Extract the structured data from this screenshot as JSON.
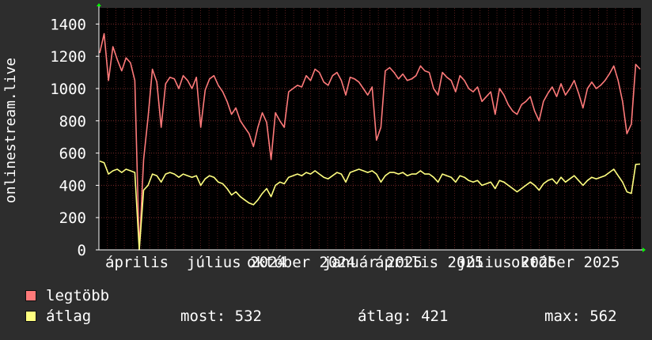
{
  "chart_data": {
    "type": "line",
    "ylabel": "onlinestream.live",
    "ylim": [
      0,
      1500
    ],
    "yticks": [
      0,
      200,
      400,
      600,
      800,
      1000,
      1200,
      1400
    ],
    "grid": true,
    "xticklabels": [
      "április",
      "július 2024",
      "október 2024",
      "január 2025",
      "április 2025",
      "július 2025",
      "október 2025"
    ],
    "series": [
      {
        "name": "legtöbb",
        "color": "#ff7a7a",
        "values": [
          1220,
          1340,
          1050,
          1260,
          1180,
          1110,
          1190,
          1160,
          1050,
          0,
          560,
          820,
          1120,
          1040,
          760,
          1030,
          1070,
          1060,
          1000,
          1080,
          1050,
          1000,
          1070,
          760,
          990,
          1060,
          1080,
          1020,
          980,
          920,
          840,
          880,
          800,
          760,
          720,
          640,
          760,
          850,
          790,
          560,
          850,
          800,
          760,
          980,
          1000,
          1020,
          1010,
          1080,
          1050,
          1120,
          1100,
          1040,
          1020,
          1080,
          1100,
          1050,
          960,
          1070,
          1060,
          1040,
          1000,
          960,
          1010,
          680,
          760,
          1110,
          1130,
          1100,
          1060,
          1090,
          1050,
          1060,
          1080,
          1140,
          1110,
          1100,
          1000,
          960,
          1100,
          1070,
          1050,
          980,
          1080,
          1050,
          1000,
          980,
          1010,
          920,
          950,
          980,
          840,
          1000,
          960,
          900,
          860,
          840,
          900,
          920,
          950,
          860,
          800,
          920,
          970,
          1010,
          950,
          1030,
          960,
          1000,
          1050,
          970,
          880,
          1000,
          1040,
          1000,
          1020,
          1050,
          1090,
          1140,
          1050,
          920,
          720,
          780,
          1150,
          1120
        ]
      },
      {
        "name": "átlag",
        "color": "#ffff80",
        "values": [
          550,
          540,
          470,
          490,
          500,
          480,
          500,
          490,
          480,
          0,
          370,
          400,
          470,
          460,
          420,
          470,
          480,
          470,
          450,
          470,
          460,
          450,
          460,
          400,
          440,
          460,
          450,
          420,
          410,
          380,
          340,
          360,
          330,
          310,
          290,
          280,
          310,
          350,
          380,
          330,
          400,
          420,
          410,
          450,
          460,
          470,
          460,
          480,
          470,
          490,
          470,
          450,
          440,
          460,
          480,
          470,
          420,
          480,
          490,
          500,
          490,
          480,
          490,
          470,
          420,
          460,
          480,
          480,
          470,
          480,
          460,
          470,
          470,
          490,
          470,
          470,
          450,
          420,
          470,
          460,
          450,
          420,
          460,
          450,
          430,
          420,
          430,
          400,
          410,
          420,
          380,
          430,
          420,
          400,
          380,
          360,
          380,
          400,
          420,
          400,
          370,
          410,
          430,
          440,
          410,
          450,
          420,
          440,
          460,
          430,
          400,
          430,
          450,
          440,
          450,
          460,
          480,
          500,
          460,
          420,
          360,
          350,
          530,
          532
        ]
      }
    ]
  },
  "legend": [
    {
      "label": "legtöbb"
    },
    {
      "label": "átlag"
    }
  ],
  "stats": {
    "now_label": "most:",
    "now_value": "532",
    "avg_label": "átlag:",
    "avg_value": "421",
    "max_label": "max:",
    "max_value": "562"
  }
}
